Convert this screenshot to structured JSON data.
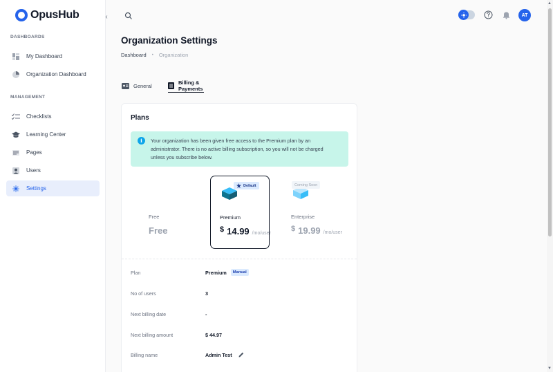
{
  "brand": {
    "name": "OpusHub"
  },
  "sidebar": {
    "sections": [
      {
        "label": "DASHBOARDS"
      },
      {
        "label": "MANAGEMENT"
      }
    ],
    "items": [
      {
        "label": "My Dashboard",
        "icon": "dashboard-icon"
      },
      {
        "label": "Organization Dashboard",
        "icon": "pie-chart-icon"
      },
      {
        "label": "Checklists",
        "icon": "checklist-icon"
      },
      {
        "label": "Learning Center",
        "icon": "graduation-cap-icon"
      },
      {
        "label": "Pages",
        "icon": "pages-icon"
      },
      {
        "label": "Users",
        "icon": "user-icon"
      },
      {
        "label": "Settings",
        "icon": "gear-icon"
      }
    ]
  },
  "topbar": {
    "avatar_initials": "AT"
  },
  "page": {
    "title": "Organization Settings",
    "breadcrumb": [
      "Dashboard",
      "Organization"
    ],
    "breadcrumb_sep": "•",
    "tabs": [
      {
        "label": "General",
        "icon": "id-card-icon"
      },
      {
        "label": "Billing & Payments",
        "icon": "list-icon"
      }
    ]
  },
  "plans_card": {
    "title": "Plans",
    "alert": "Your organization has been given free access to the Premium plan by an administrator. There is no active billing subscription, so you will not be charged unless you subscribe below.",
    "plans": [
      {
        "name": "Free",
        "price_text": "Free"
      },
      {
        "name": "Premium",
        "badge": "Default",
        "currency": "$",
        "amount": "14.99",
        "unit": "/mo/user"
      },
      {
        "name": "Enterprise",
        "badge": "Coming Soon",
        "currency": "$",
        "amount": "19.99",
        "unit": "/mo/user"
      }
    ],
    "details": [
      {
        "label": "Plan",
        "value": "Premium",
        "badge": "Manual"
      },
      {
        "label": "No of users",
        "value": "3"
      },
      {
        "label": "Next billing date",
        "value": "-"
      },
      {
        "label": "Next billing amount",
        "value": "$ 44.97"
      },
      {
        "label": "Billing name",
        "value": "Admin Test"
      }
    ]
  },
  "colors": {
    "accent": "#2563eb",
    "alert_bg": "#c7f5ea",
    "active_nav_bg": "#e8eefc"
  }
}
